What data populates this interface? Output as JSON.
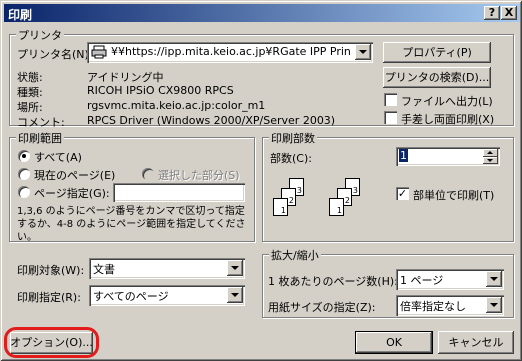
{
  "title": "印刷",
  "titlebar_buttons": {
    "help": "?",
    "close": "X"
  },
  "printer": {
    "group_label": "プリンタ",
    "name_label": "プリンタ名(N):",
    "name_value": "¥¥https://ipp.mita.keio.ac.jp¥RGate IPP Prin",
    "status_label": "状態:",
    "status_value": "アイドリング中",
    "type_label": "種類:",
    "type_value": "RICOH IPSiO CX9800 RPCS",
    "location_label": "場所:",
    "location_value": "rgsvmc.mita.keio.ac.jp:color_m1",
    "comment_label": "コメント:",
    "comment_value": "RPCS Driver (Windows 2000/XP/Server 2003)",
    "properties_button": "プロパティ(P)",
    "find_button": "プリンタの検索(D)...",
    "print_to_file": "ファイルへ出力(L)",
    "manual_duplex": "手差し両面印刷(X)"
  },
  "range": {
    "group_label": "印刷範囲",
    "all": "すべて(A)",
    "current_page": "現在のページ(E)",
    "selection": "選択した部分(S)",
    "pages": "ページ指定(G):",
    "pages_value": "",
    "hint": "1,3,6 のようにページ番号をカンマで区切って指定するか、4-8 のようにページ範囲を指定してください。"
  },
  "copies": {
    "group_label": "印刷部数",
    "copies_label": "部数(C):",
    "copies_value": "1",
    "collate_label": "部単位で印刷(T)",
    "collate_checked": true,
    "page_numbers": [
      "1",
      "2",
      "3",
      "1",
      "2",
      "3"
    ]
  },
  "print_what": {
    "label": "印刷対象(W):",
    "value": "文書"
  },
  "print_mode": {
    "label": "印刷指定(R):",
    "value": "すべてのページ"
  },
  "zoom": {
    "group_label": "拡大/縮小",
    "pages_per_sheet_label": "1 枚あたりのページ数(H):",
    "pages_per_sheet_value": "1 ページ",
    "scale_label": "用紙サイズの指定(Z):",
    "scale_value": "倍率指定なし"
  },
  "footer": {
    "options_button": "オプション(O)...",
    "ok_button": "OK",
    "cancel_button": "キャンセル"
  },
  "colors": {
    "highlight": "#e31b1b",
    "titlebar": "#0a246a"
  }
}
